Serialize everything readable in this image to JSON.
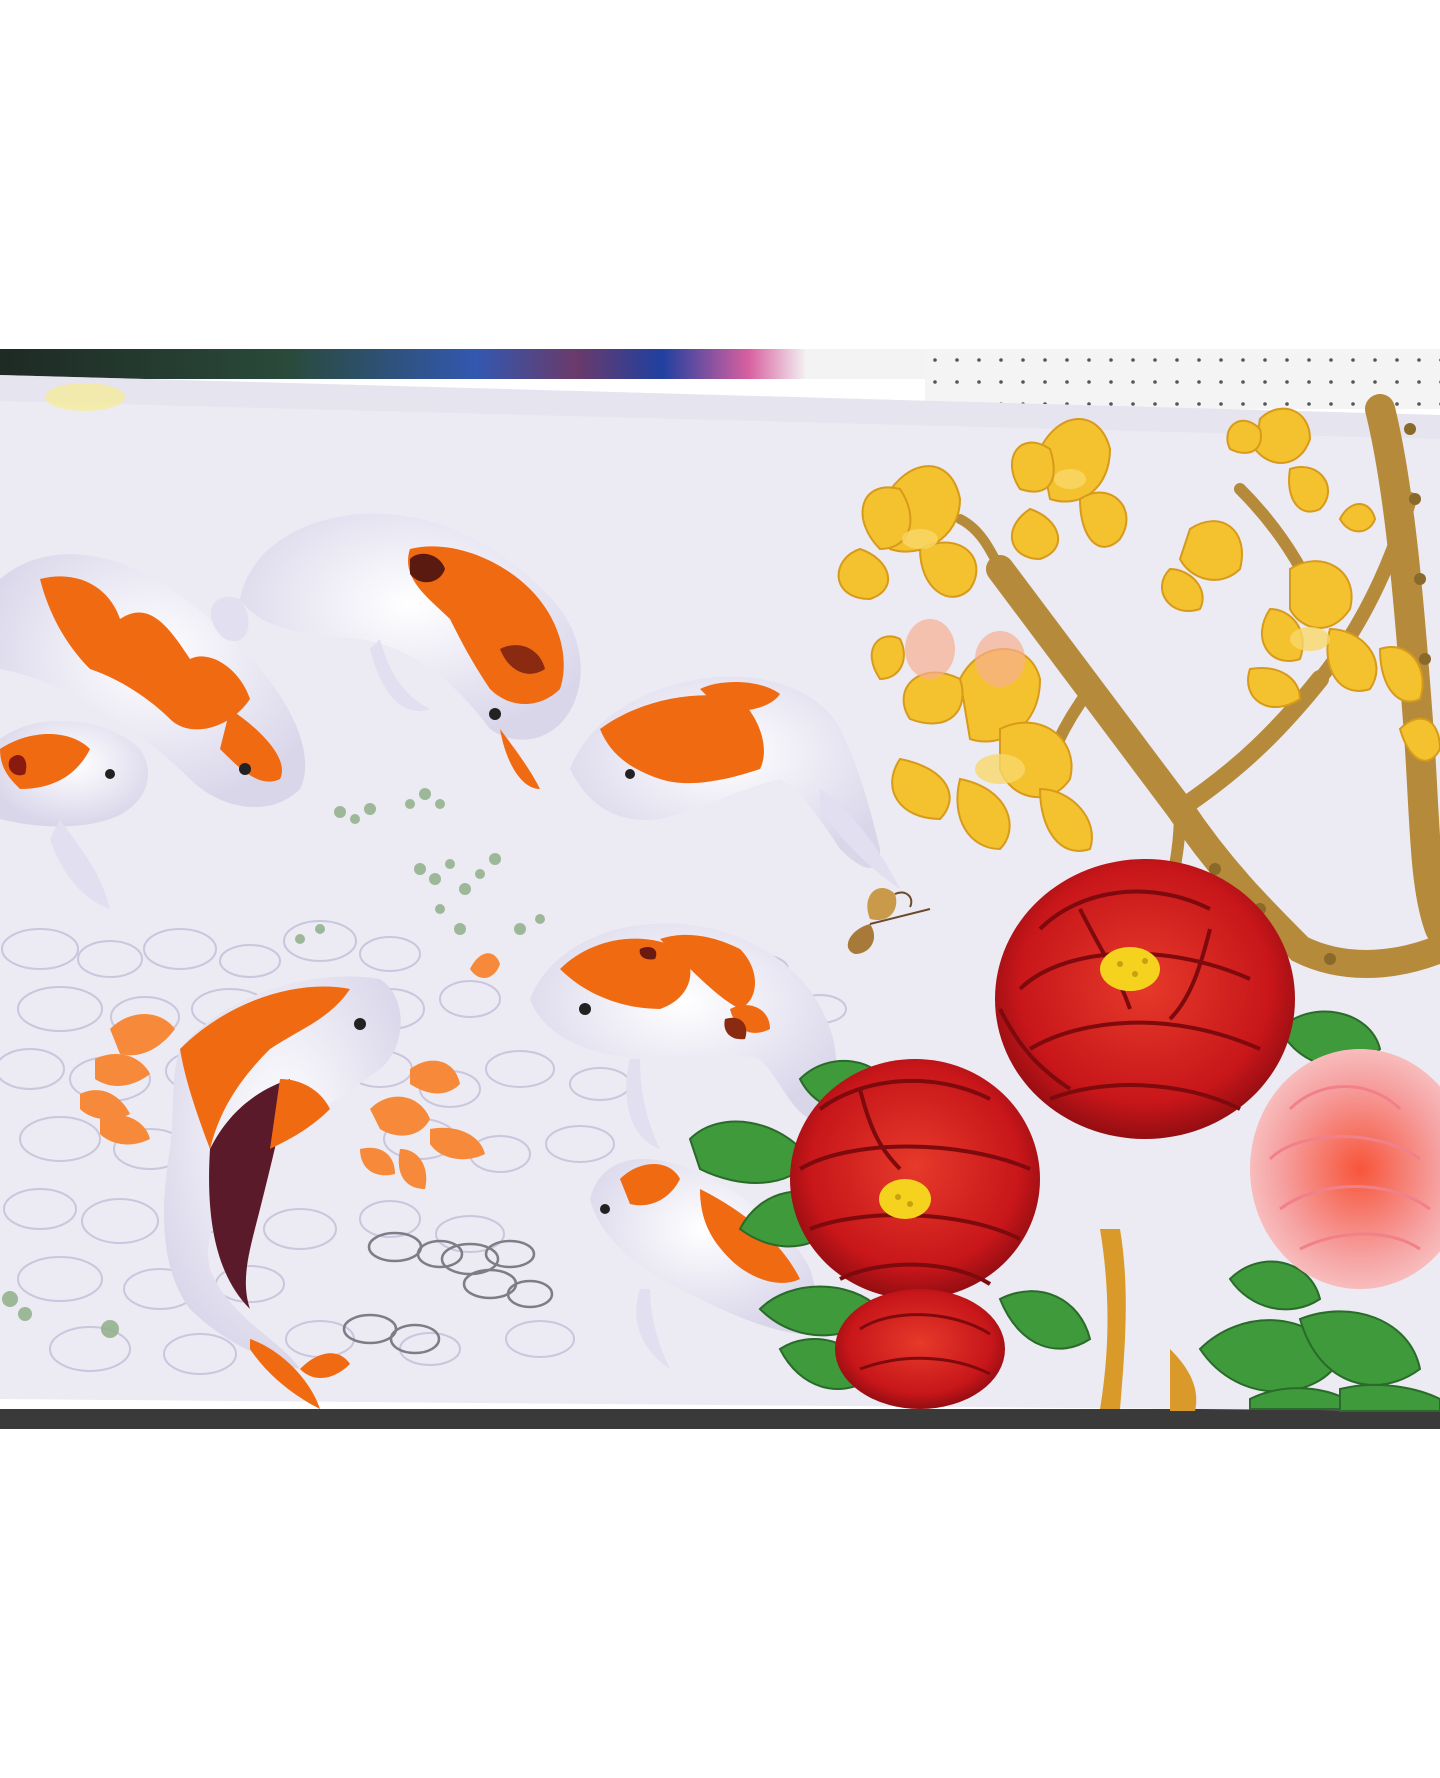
{
  "image": {
    "subject": "koi-and-flower-oil-painting-photo",
    "colors": {
      "page_background": "#ffffff",
      "canvas": "#eceaf2",
      "canvas_shadow": "#dcd9e6",
      "pebble_stroke": "#c9c6dd",
      "koi_white": "#f6f4f8",
      "koi_orange": "#f06a12",
      "koi_dark": "#5a1a2a",
      "peony_red": "#c8161a",
      "peony_dark": "#8e0c10",
      "peony_pink": "#f6a0a0",
      "magnolia_yellow": "#f4c22e",
      "branch_brown": "#b58a3a",
      "leaf_green": "#3e9a3a",
      "backdrop_dark": "#2a3a30",
      "pegboard": "#f3f3f3"
    }
  }
}
